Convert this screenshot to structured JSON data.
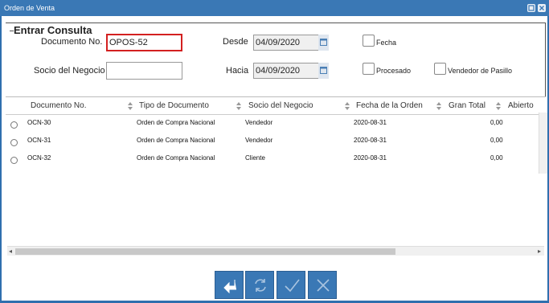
{
  "window": {
    "title": "Orden de Venta"
  },
  "form": {
    "legend": "Entrar Consulta",
    "documento_label": "Documento No.",
    "documento_value": "OPOS-52",
    "socio_label": "Socio del Negocio",
    "socio_value": "",
    "desde_label": "Desde",
    "desde_value": "04/09/2020",
    "hacia_label": "Hacia",
    "hacia_value": "04/09/2020",
    "fecha_label": "Fecha",
    "procesado_label": "Procesado",
    "vendedor_label": "Vendedor de Pasillo"
  },
  "table": {
    "columns": [
      "Documento No.",
      "Tipo de Documento",
      "Socio del Negocio",
      "Fecha de la Orden",
      "Gran Total",
      "Abierto"
    ],
    "rows": [
      {
        "doc": "OCN-30",
        "tipo": "Orden de Compra Nacional",
        "socio": "Vendedor",
        "fecha": "2020-08-31",
        "total": "0,00"
      },
      {
        "doc": "OCN-31",
        "tipo": "Orden de Compra Nacional",
        "socio": "Vendedor",
        "fecha": "2020-08-31",
        "total": "0,00"
      },
      {
        "doc": "OCN-32",
        "tipo": "Orden de Compra Nacional",
        "socio": "Cliente",
        "fecha": "2020-08-31",
        "total": "0,00"
      }
    ]
  },
  "colors": {
    "accent": "#3a78b5",
    "focus_border": "#d32020"
  }
}
